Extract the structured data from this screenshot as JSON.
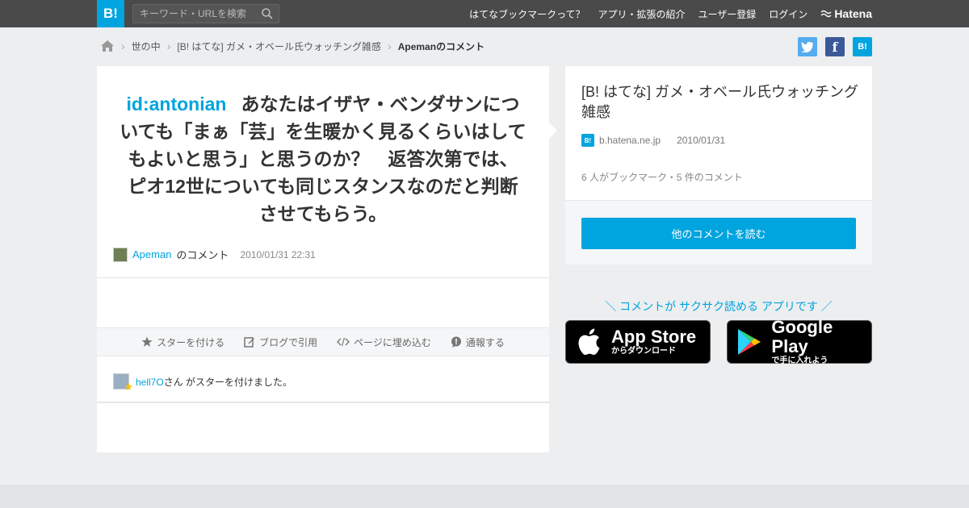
{
  "header": {
    "logo_text": "B!",
    "search_placeholder": "キーワード・URLを検索",
    "nav": [
      "はてなブックマークって？",
      "アプリ・拡張の紹介",
      "ユーザー登録",
      "ログイン"
    ],
    "brand": "Hatena"
  },
  "breadcrumb": {
    "items": [
      "世の中",
      "[B! はてな] ガメ・オベール氏ウォッチング雑感"
    ],
    "current": "Apemanのコメント"
  },
  "share": {
    "twitter": "t",
    "facebook": "f",
    "hatena": "B!"
  },
  "comment": {
    "id_link": "id:antonian",
    "text": "あなたはイザヤ・ベンダサンについても「まぁ「芸」を生暖かく見るくらいはしてもよいと思う」と思うのか？　返答次第では、ピオ12世についても同じスタンスなのだと判断させてもらう。",
    "user": "Apeman",
    "user_suffix": "のコメント",
    "datetime": "2010/01/31 22:31"
  },
  "actions": {
    "star": "スターを付ける",
    "blog": "ブログで引用",
    "embed": "ページに埋め込む",
    "report": "通報する"
  },
  "stars": {
    "user": "hell7O",
    "text": "さん がスターを付けました。"
  },
  "entry": {
    "title": "[B! はてな] ガメ・オベール氏ウォッチング雑感",
    "site_icon": "B!",
    "site": "b.hatena.ne.jp",
    "date": "2010/01/31",
    "counts": "6 人がブックマーク・5 件のコメント",
    "read_more": "他のコメントを読む"
  },
  "promo": {
    "headline": "＼ コメントが サクサク読める アプリです ／",
    "appstore_big": "App Store",
    "appstore_small": "からダウンロード",
    "googleplay_big": "Google Play",
    "googleplay_small": "で手に入れよう"
  },
  "colors": {
    "accent": "#00a4de",
    "topbar": "#4a4a4a",
    "background": "#eceef0"
  }
}
